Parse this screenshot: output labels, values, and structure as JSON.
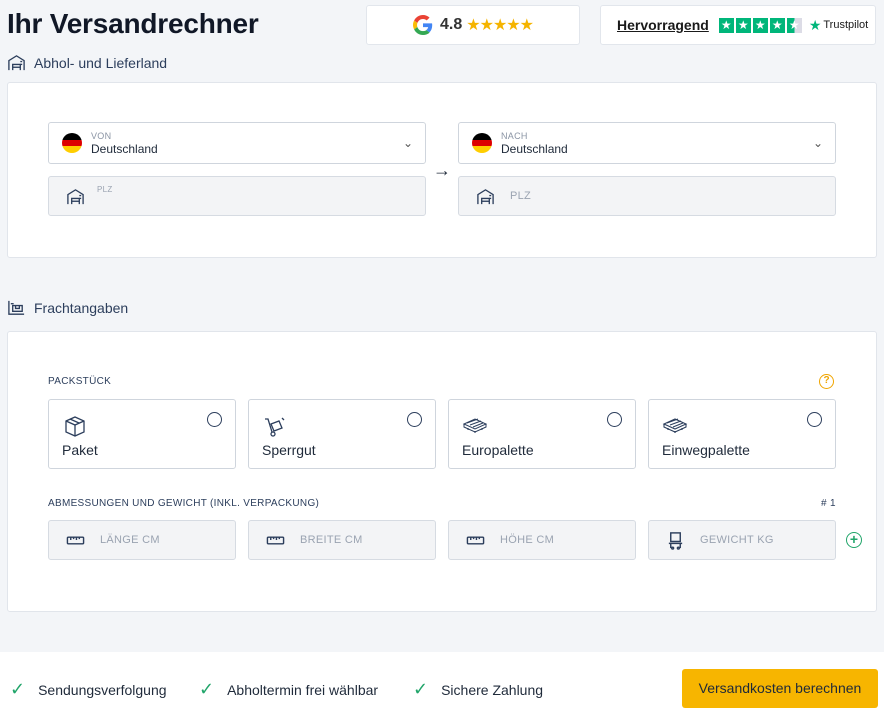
{
  "header": {
    "title": "Ihr Versandrechner",
    "google": {
      "rating": "4.8",
      "stars": "★★★★★"
    },
    "trustpilot": {
      "verdict": "Hervorragend",
      "brand": "Trustpilot",
      "star_glyph": "★"
    }
  },
  "route": {
    "section_label": "Abhol- und Lieferland",
    "from": {
      "label": "VON",
      "value": "Deutschland",
      "plz_label": "PLZ"
    },
    "arrow": "→",
    "to": {
      "label": "NACH",
      "value": "Deutschland",
      "plz_placeholder": "PLZ"
    },
    "chevron": "⌄"
  },
  "freight": {
    "section_label": "Frachtangaben",
    "packstueck_label": "PACKSTÜCK",
    "help": "?",
    "options": [
      {
        "label": "Paket",
        "icon": "box-icon"
      },
      {
        "label": "Sperrgut",
        "icon": "hand-truck-icon"
      },
      {
        "label": "Europalette",
        "icon": "pallet-icon"
      },
      {
        "label": "Einwegpalette",
        "icon": "disposable-pallet-icon"
      }
    ],
    "dimensions_label": "ABMESSUNGEN UND GEWICHT (INKL. VERPACKUNG)",
    "item_number": "# 1",
    "fields": {
      "length": "LÄNGE CM",
      "width": "BREITE CM",
      "height": "HÖHE CM",
      "weight": "GEWICHT KG"
    },
    "add": "+"
  },
  "footer": {
    "features": [
      "Sendungsverfolgung",
      "Abholtermin frei wählbar",
      "Sichere Zahlung"
    ],
    "check_glyph": "✓",
    "cta": "Versandkosten berechnen"
  },
  "colors": {
    "accent": "#f7b500",
    "success": "#21a56a",
    "trustpilot": "#00b67a",
    "text": "#1f2a3a"
  }
}
